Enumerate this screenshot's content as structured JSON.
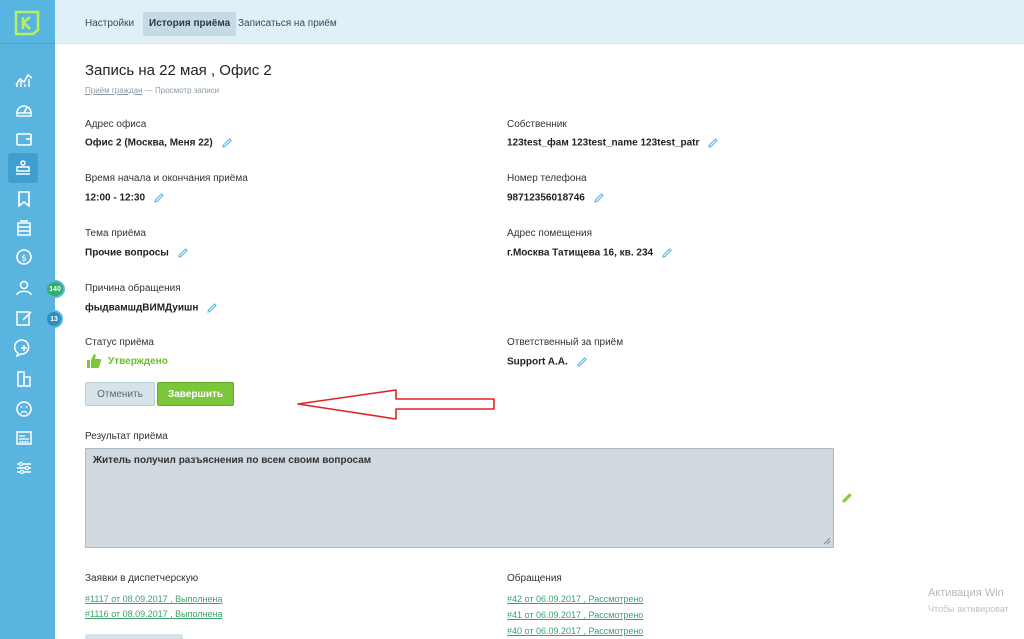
{
  "topbar": {
    "tabs": [
      {
        "label": "Настройки"
      },
      {
        "label": "История приёма"
      },
      {
        "label": "Записаться на приём"
      }
    ]
  },
  "sidebar": {
    "badges": {
      "complaints": "140",
      "requests": "13"
    }
  },
  "page": {
    "title": "Запись на 22 мая , Офис 2",
    "breadcrumb_link": "Приём граждан",
    "breadcrumb_current": "— Просмотр записи"
  },
  "fields": {
    "office_address_label": "Адрес офиса",
    "office_address_value": "Офис 2 (Москва, Меня 22)",
    "owner_label": "Собственник",
    "owner_value": "123test_фам 123test_name 123test_patr",
    "time_label": "Время начала и окончания приёма",
    "time_value": "12:00 - 12:30",
    "phone_label": "Номер телефона",
    "phone_value": "98712356018746",
    "topic_label": "Тема приёма",
    "topic_value": "Прочие вопросы",
    "premises_label": "Адрес помещения",
    "premises_value": "г.Москва Татищева 16, кв. 234",
    "reason_label": "Причина обращения",
    "reason_value": "фыдвамшдВИМДуишн",
    "status_label": "Статус приёма",
    "status_value": "Утверждено",
    "responsible_label": "Ответственный за приём",
    "responsible_value": "Support A.A."
  },
  "actions": {
    "cancel_label": "Отменить",
    "finish_label": "Завершить"
  },
  "result": {
    "label": "Результат приёма",
    "text": "Житель получил разъяснения по всем своим вопросам"
  },
  "dispatch": {
    "label": "Заявки в диспетчерскую",
    "items": [
      "#1117 от 08.09.2017 , Выполнена",
      "#1116 от 08.09.2017 , Выполнена"
    ]
  },
  "appeals": {
    "label": "Обращения",
    "items": [
      "#42 от 06.09.2017 , Рассмотрено",
      "#41 от 06.09.2017 , Рассмотрено",
      "#40 от 06.09.2017 , Рассмотрено"
    ]
  },
  "watermark": {
    "title": "Активация Win",
    "subtitle": "Чтобы активироват"
  },
  "colors": {
    "sidebar": "#5ab4e0",
    "topbar": "#dff1f7",
    "accent_green": "#7cc63a",
    "link_green": "#3aa36a",
    "arrow_red": "#e02424"
  }
}
